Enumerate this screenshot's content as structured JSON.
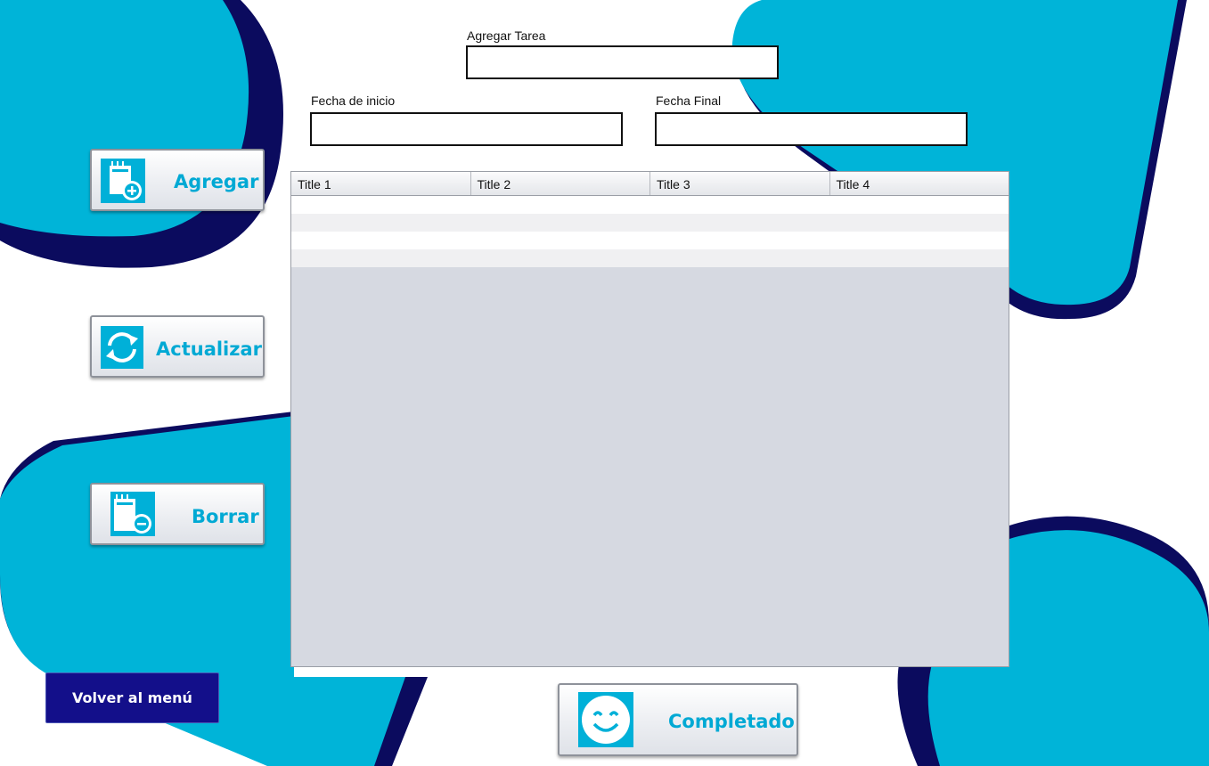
{
  "form": {
    "task_label": "Agregar Tarea",
    "task_value": "",
    "start_label": "Fecha de inicio",
    "start_value": "",
    "end_label": "Fecha Final",
    "end_value": ""
  },
  "actions": {
    "add": {
      "label": "Agregar",
      "icon": "notepad-add-icon"
    },
    "update": {
      "label": "Actualizar",
      "icon": "refresh-icon"
    },
    "delete": {
      "label": "Borrar",
      "icon": "notepad-remove-icon"
    },
    "complete": {
      "label": "Completado",
      "icon": "smiley-icon"
    },
    "back": {
      "label": "Volver al menú"
    }
  },
  "table": {
    "columns": [
      "Title 1",
      "Title 2",
      "Title 3",
      "Title 4"
    ],
    "rows": [
      [
        "",
        "",
        "",
        ""
      ],
      [
        "",
        "",
        "",
        ""
      ],
      [
        "",
        "",
        "",
        ""
      ],
      [
        "",
        "",
        "",
        ""
      ]
    ]
  },
  "colors": {
    "accent": "#00b0d8",
    "navy": "#0b0b5e",
    "button_text": "#00a9d4",
    "back_button": "#130f8a"
  }
}
